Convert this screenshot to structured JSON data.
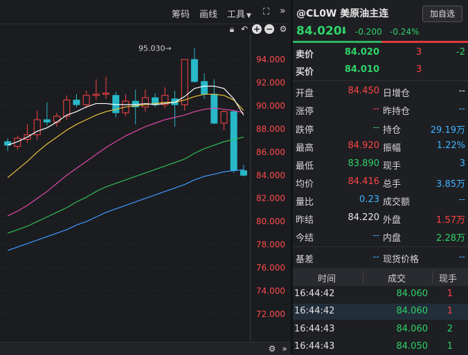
{
  "toolbar": {
    "chips": "筹码",
    "draw": "画线",
    "tools": "工具",
    "expand": "»"
  },
  "chart": {
    "peak_label": "95.030→",
    "y_ticks": [
      "94.000",
      "92.000",
      "90.000",
      "88.000",
      "86.000",
      "84.000",
      "82.000",
      "80.000",
      "78.000",
      "76.000",
      "74.000",
      "72.000"
    ],
    "candles": [
      {
        "o": 86.9,
        "h": 87.2,
        "l": 86.1,
        "c": 86.6
      },
      {
        "o": 86.5,
        "h": 87.4,
        "l": 86.2,
        "c": 87.2
      },
      {
        "o": 87.1,
        "h": 88.4,
        "l": 86.8,
        "c": 87.5
      },
      {
        "o": 87.5,
        "h": 89.6,
        "l": 87.1,
        "c": 88.8
      },
      {
        "o": 88.8,
        "h": 90.3,
        "l": 88.3,
        "c": 88.6
      },
      {
        "o": 88.6,
        "h": 89.4,
        "l": 88.2,
        "c": 89.1
      },
      {
        "o": 89.1,
        "h": 90.9,
        "l": 88.8,
        "c": 90.5
      },
      {
        "o": 90.5,
        "h": 91.0,
        "l": 89.9,
        "c": 90.1
      },
      {
        "o": 90.1,
        "h": 91.3,
        "l": 89.8,
        "c": 90.9
      },
      {
        "o": 90.9,
        "h": 92.3,
        "l": 90.5,
        "c": 91.0
      },
      {
        "o": 91.0,
        "h": 92.5,
        "l": 90.6,
        "c": 91.1
      },
      {
        "o": 90.9,
        "h": 91.2,
        "l": 89.0,
        "c": 89.4
      },
      {
        "o": 89.4,
        "h": 91.0,
        "l": 89.1,
        "c": 90.4
      },
      {
        "o": 90.4,
        "h": 91.4,
        "l": 88.4,
        "c": 89.9
      },
      {
        "o": 89.9,
        "h": 91.4,
        "l": 89.5,
        "c": 90.7
      },
      {
        "o": 90.7,
        "h": 91.1,
        "l": 89.9,
        "c": 90.1
      },
      {
        "o": 90.1,
        "h": 91.6,
        "l": 89.8,
        "c": 90.9
      },
      {
        "o": 90.6,
        "h": 91.3,
        "l": 88.2,
        "c": 90.1
      },
      {
        "o": 90.1,
        "h": 93.8,
        "l": 89.6,
        "c": 94.0
      },
      {
        "o": 94.0,
        "h": 95.0,
        "l": 92.0,
        "c": 92.1
      },
      {
        "o": 92.1,
        "h": 92.8,
        "l": 90.6,
        "c": 91.0
      },
      {
        "o": 91.0,
        "h": 92.3,
        "l": 88.4,
        "c": 88.5
      },
      {
        "o": 88.5,
        "h": 89.6,
        "l": 87.9,
        "c": 89.5
      },
      {
        "o": 89.5,
        "h": 89.6,
        "l": 84.2,
        "c": 84.4
      },
      {
        "o": 84.4,
        "h": 84.9,
        "l": 83.9,
        "c": 84.0
      }
    ],
    "ma5": [
      86.6,
      86.9,
      87.3,
      87.8,
      88.1,
      88.6,
      89.2,
      89.5,
      89.9,
      90.2,
      90.2,
      90.1,
      90.1,
      90.1,
      90.2,
      90.1,
      90.2,
      90.3,
      90.8,
      91.5,
      91.7,
      91.7,
      91.5,
      90.6,
      89.2
    ],
    "ma10": [
      83.8,
      84.5,
      85.2,
      86.0,
      86.7,
      87.3,
      87.9,
      88.4,
      88.8,
      89.2,
      89.5,
      89.7,
      89.9,
      90.0,
      90.1,
      90.2,
      90.3,
      90.3,
      90.5,
      90.8,
      91.0,
      91.0,
      90.9,
      90.5,
      89.6
    ],
    "ma20": [
      80.5,
      80.9,
      81.4,
      82.0,
      82.6,
      83.3,
      84.0,
      84.6,
      85.2,
      85.8,
      86.4,
      86.9,
      87.4,
      87.8,
      88.2,
      88.5,
      88.8,
      89.0,
      89.2,
      89.5,
      89.7,
      89.8,
      89.7,
      89.6,
      89.4
    ],
    "ma40": [
      79.0,
      79.3,
      79.6,
      80.0,
      80.4,
      80.8,
      81.2,
      81.7,
      82.1,
      82.6,
      83.0,
      83.3,
      83.6,
      83.9,
      84.2,
      84.5,
      84.8,
      85.1,
      85.4,
      85.9,
      86.3,
      86.6,
      86.9,
      87.1,
      87.3
    ],
    "ma60": [
      77.5,
      77.8,
      78.1,
      78.4,
      78.7,
      79.0,
      79.3,
      79.7,
      80.0,
      80.4,
      80.8,
      81.1,
      81.4,
      81.7,
      82.0,
      82.3,
      82.6,
      82.9,
      83.2,
      83.6,
      83.9,
      84.1,
      84.3,
      84.4,
      84.5
    ]
  },
  "quote": {
    "title": "@CL0W 美原油主连",
    "add_btn": "加自选",
    "price": "84.020",
    "arrow": "⬇",
    "change": "-0.200",
    "pct": "-0.24%",
    "ask_label": "卖价",
    "ask_price": "84.020",
    "ask_vol": "3",
    "ask_diff": "-2",
    "bid_label": "买价",
    "bid_price": "84.010",
    "bid_vol": "3",
    "open_l": "开盘",
    "open_v": "84.450",
    "dayinc_l": "日增仓",
    "dayinc_v": "--",
    "limitup_l": "涨停",
    "limitup_v": "--",
    "prevoi_l": "昨持仓",
    "prevoi_v": "--",
    "limitdn_l": "跌停",
    "limitdn_v": "--",
    "oi_l": "持仓",
    "oi_v": "29.19万",
    "high_l": "最高",
    "high_v": "84.920",
    "amp_l": "振幅",
    "amp_v": "1.22%",
    "low_l": "最低",
    "low_v": "83.890",
    "cur_l": "现手",
    "cur_v": "3",
    "avg_l": "均价",
    "avg_v": "84.416",
    "tot_l": "总手",
    "tot_v": "3.85万",
    "vr_l": "量比",
    "vr_v": "0.23",
    "amt_l": "成交额",
    "amt_v": "--",
    "prev_l": "昨结",
    "prev_v": "84.220",
    "outer_l": "外盘",
    "outer_v": "1.57万",
    "today_l": "今结",
    "today_v": "--",
    "inner_l": "内盘",
    "inner_v": "2.28万",
    "basis_l": "基差",
    "basis_v": "--",
    "spot_l": "现货价格",
    "spot_v": "--"
  },
  "ticks": {
    "headers": [
      "时间",
      "成交",
      "现手"
    ],
    "rows": [
      {
        "time": "16:44:42",
        "price": "84.060",
        "qty": "1"
      },
      {
        "time": "16:44:42",
        "price": "84.060",
        "qty": "1"
      },
      {
        "time": "16:44:43",
        "price": "84.060",
        "qty": "2"
      },
      {
        "time": "16:44:43",
        "price": "84.050",
        "qty": "1"
      }
    ]
  },
  "colors": {
    "up": "#ff4545",
    "down": "#2fd468",
    "ma5": "#ffffff",
    "ma10": "#e8c23a",
    "ma20": "#e04aa8",
    "ma40": "#2fc05a",
    "ma60": "#3f9bff"
  }
}
